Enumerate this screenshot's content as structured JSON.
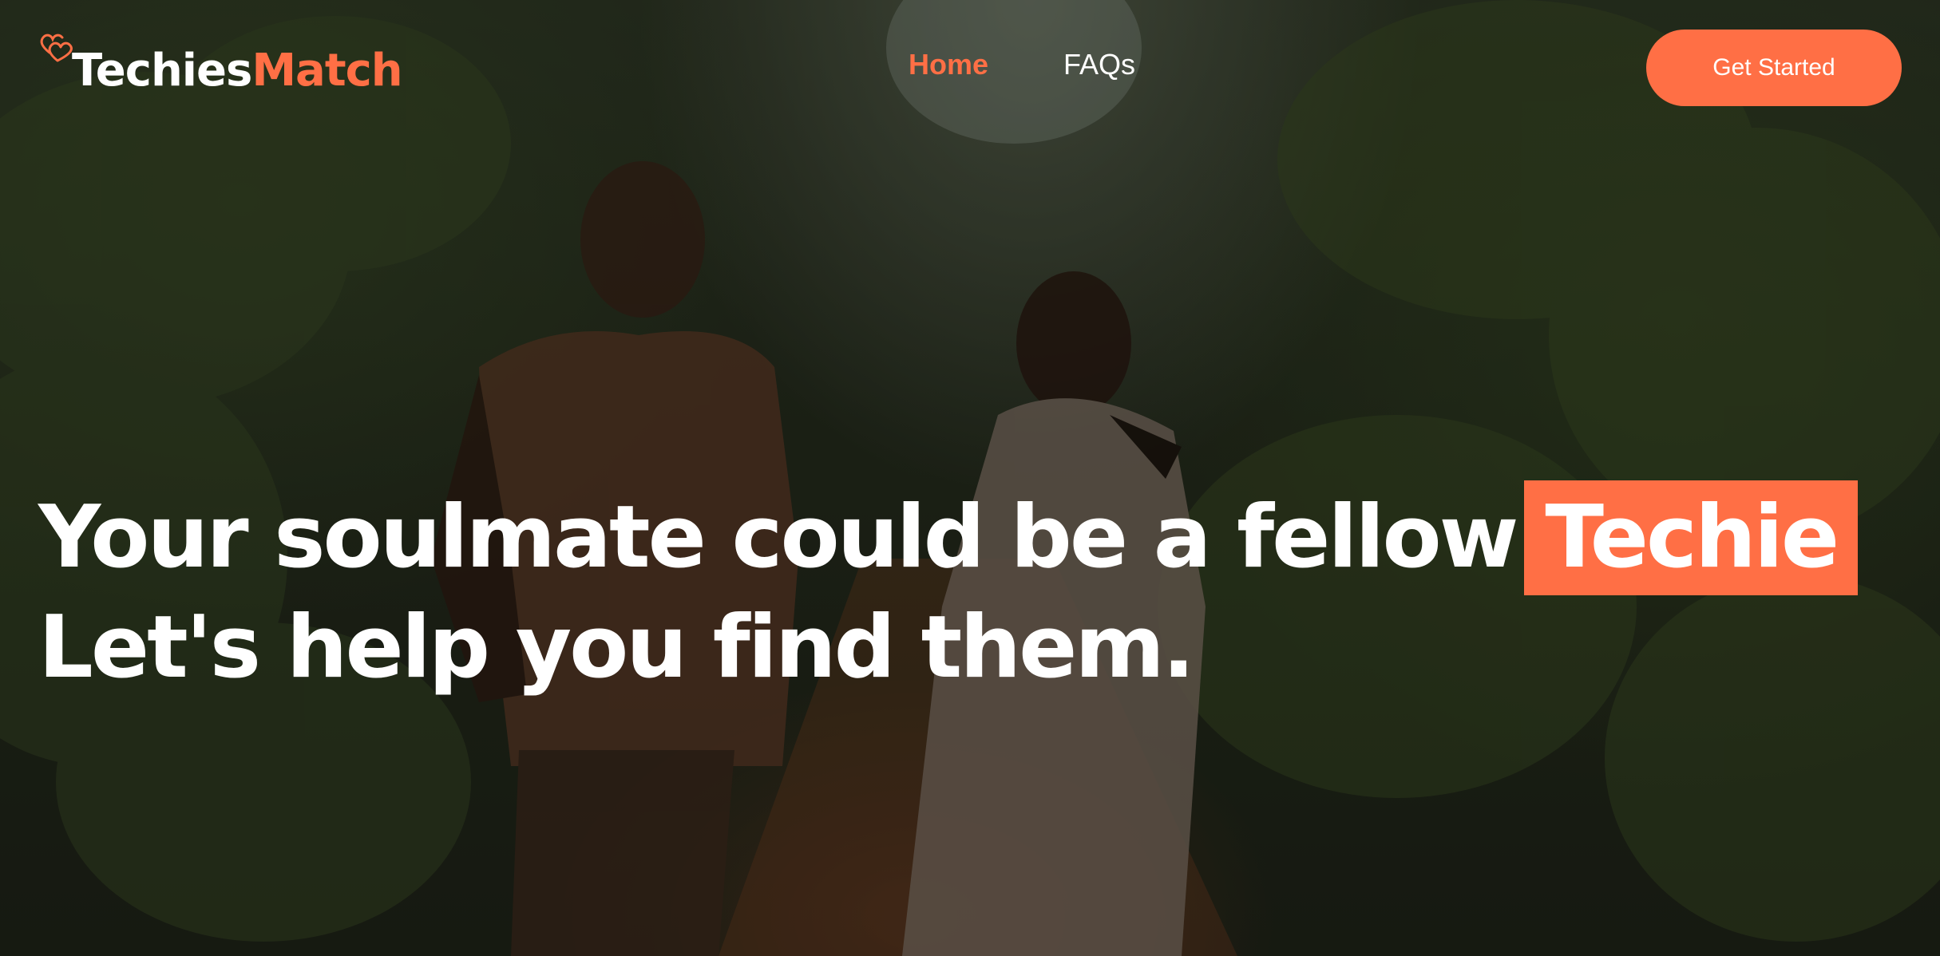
{
  "brand": {
    "name_part1": "Techies",
    "name_part2": "Match",
    "icon": "hearts-icon",
    "accent_color": "#ff6f45"
  },
  "nav": {
    "items": [
      {
        "label": "Home",
        "active": true
      },
      {
        "label": "FAQs",
        "active": false
      }
    ]
  },
  "cta": {
    "label": "Get Started"
  },
  "hero": {
    "headline_line1": "Your soulmate could be a fellow",
    "headline_highlight": "Techie",
    "headline_line2": "Let's help you find them.",
    "background_image": "couple-running-on-forest-path-photo"
  }
}
